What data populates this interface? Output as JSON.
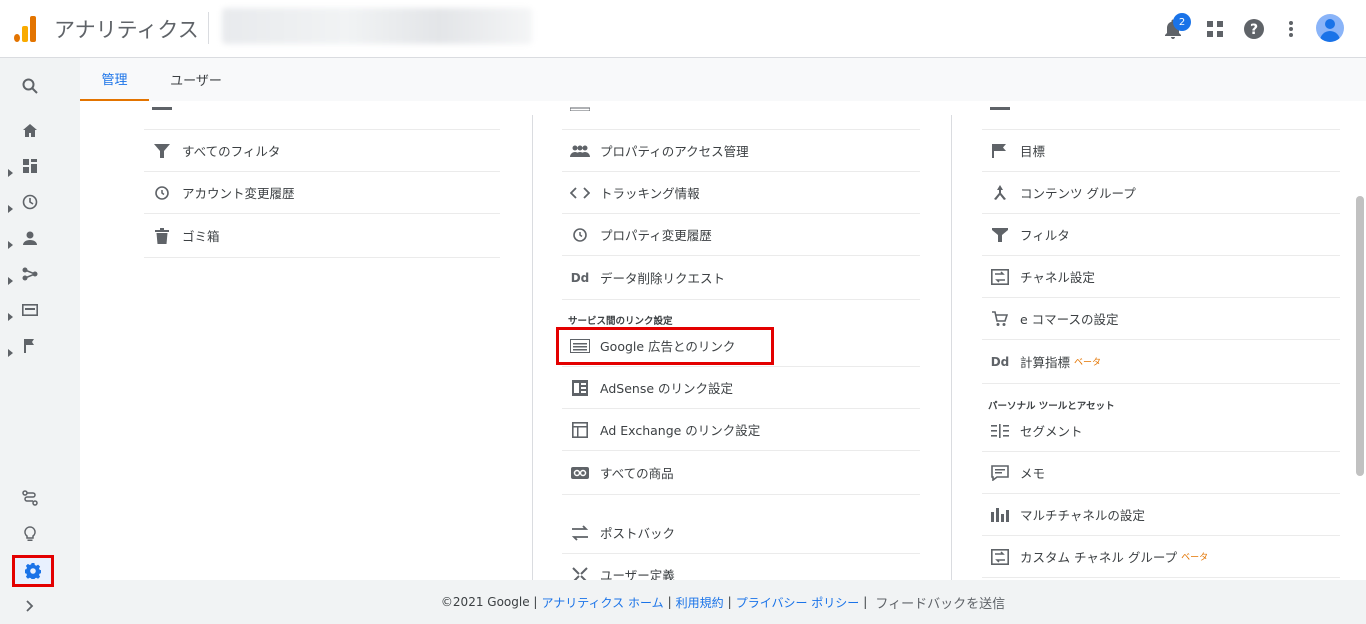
{
  "header": {
    "app_title": "アナリティクス",
    "notification_count": "2"
  },
  "tabs": [
    {
      "label": "管理"
    },
    {
      "label": "ユーザー"
    }
  ],
  "col1": {
    "items": [
      {
        "label": "すべてのフィルタ",
        "icon": "filter-icon"
      },
      {
        "label": "アカウント変更履歴",
        "icon": "history-icon"
      },
      {
        "label": "ゴミ箱",
        "icon": "trash-icon"
      }
    ]
  },
  "col2": {
    "items": [
      {
        "label": "プロパティのアクセス管理",
        "icon": "people-icon"
      },
      {
        "label": "トラッキング情報",
        "icon": "code-icon"
      },
      {
        "label": "プロパティ変更履歴",
        "icon": "history-icon"
      },
      {
        "label": "データ削除リクエスト",
        "icon": "dd-icon"
      }
    ],
    "section_label": "サービス間のリンク設定",
    "link_items": [
      {
        "label": "Google 広告とのリンク",
        "icon": "ads-icon"
      },
      {
        "label": "AdSense のリンク設定",
        "icon": "adsense-icon"
      },
      {
        "label": "Ad Exchange のリンク設定",
        "icon": "adexchange-icon"
      },
      {
        "label": "すべての商品",
        "icon": "link-icon"
      },
      {
        "label": "ポストバック",
        "icon": "postback-icon"
      },
      {
        "label": "ユーザー定義",
        "icon": "userdef-icon"
      }
    ]
  },
  "col3": {
    "items": [
      {
        "label": "目標",
        "icon": "flag-icon"
      },
      {
        "label": "コンテンツ グループ",
        "icon": "content-group-icon"
      },
      {
        "label": "フィルタ",
        "icon": "filter-icon"
      },
      {
        "label": "チャネル設定",
        "icon": "channel-icon"
      },
      {
        "label": "e コマースの設定",
        "icon": "cart-icon"
      },
      {
        "label": "計算指標",
        "icon": "dd-icon",
        "beta": "ベータ"
      }
    ],
    "section_label": "パーソナル ツールとアセット",
    "personal_items": [
      {
        "label": "セグメント",
        "icon": "segment-icon"
      },
      {
        "label": "メモ",
        "icon": "memo-icon"
      },
      {
        "label": "マルチチャネルの設定",
        "icon": "bar-icon"
      },
      {
        "label": "カスタム チャネル グループ",
        "icon": "channel-icon",
        "beta": "ベータ"
      }
    ]
  },
  "footer": {
    "copyright": "©2021 Google |",
    "links": [
      "アナリティクス ホーム",
      "利用規約",
      "プライバシー ポリシー"
    ],
    "feedback": "フィードバックを送信"
  }
}
